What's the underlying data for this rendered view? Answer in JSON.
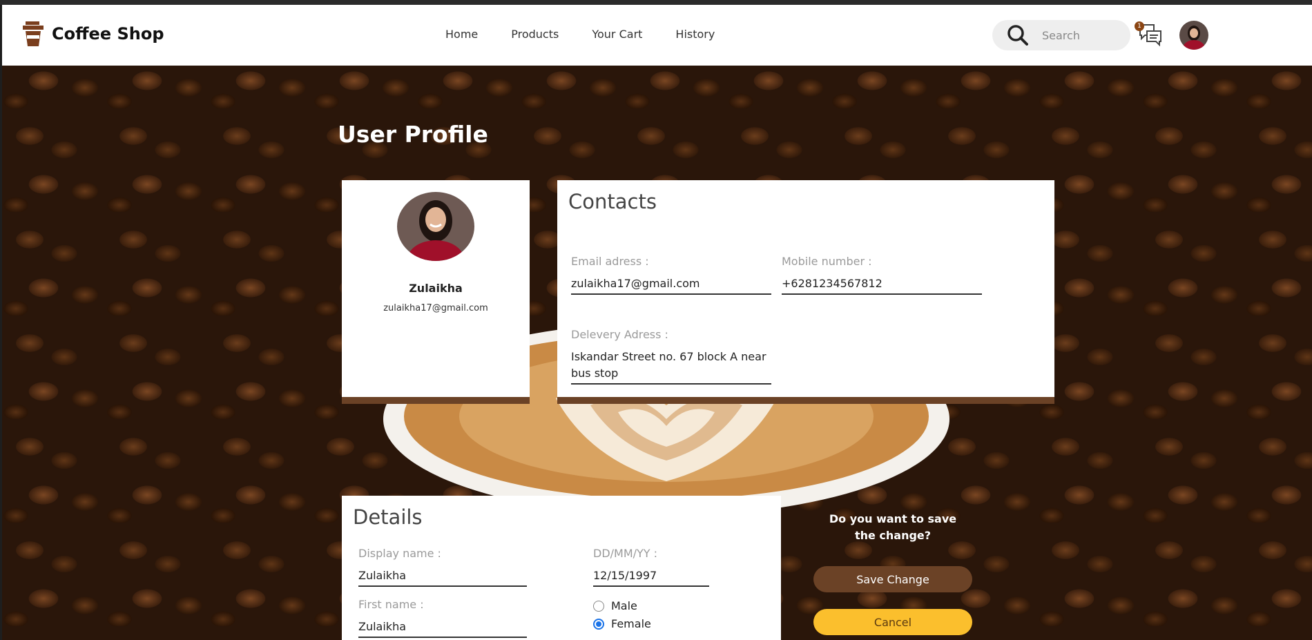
{
  "brand": {
    "name": "Coffee Shop"
  },
  "nav": {
    "items": [
      "Home",
      "Products",
      "Your Cart",
      "History"
    ]
  },
  "search": {
    "placeholder": "Search"
  },
  "notifications": {
    "count": "1"
  },
  "page": {
    "title": "User Profile"
  },
  "profile": {
    "name": "Zulaikha",
    "email": "zulaikha17@gmail.com"
  },
  "contacts": {
    "title": "Contacts",
    "email_label": "Email adress :",
    "email_value": "zulaikha17@gmail.com",
    "mobile_label": "Mobile number :",
    "mobile_value": "+6281234567812",
    "address_label": "Delevery Adress :",
    "address_value": "Iskandar Street no. 67 block A near bus stop"
  },
  "details": {
    "title": "Details",
    "display_name_label": "Display name :",
    "display_name_value": "Zulaikha",
    "dob_label": "DD/MM/YY :",
    "dob_value": "12/15/1997",
    "first_name_label": "First name :",
    "first_name_value": "Zulaikha",
    "gender_options": [
      "Male",
      "Female"
    ],
    "gender_selected": "Female"
  },
  "actions": {
    "prompt": "Do you want to save the change?",
    "save_label": "Save Change",
    "cancel_label": "Cancel"
  },
  "colors": {
    "accent": "#6b4226",
    "cancel": "#fbbf2d",
    "radio": "#1a73e8"
  },
  "icons": [
    "coffee-cup-icon",
    "search-icon",
    "chat-icon",
    "avatar"
  ]
}
